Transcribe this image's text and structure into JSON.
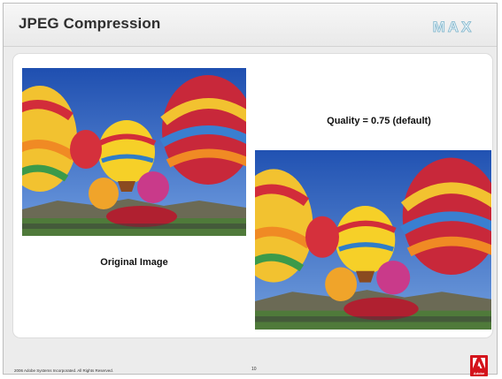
{
  "slide": {
    "title": "JPEG Compression",
    "logo_text": "MAX"
  },
  "images": {
    "original_caption": "Original Image",
    "compressed_caption": "Quality = 0.75 (default)"
  },
  "footer": {
    "copyright": "2006 Adobe Systems Incorporated.  All Rights Reserved.",
    "page_number": "10",
    "brand": "Adobe"
  },
  "colors": {
    "sky": "#2e5fb8",
    "grass": "#4f7a3a",
    "brand_red": "#d4141c"
  }
}
